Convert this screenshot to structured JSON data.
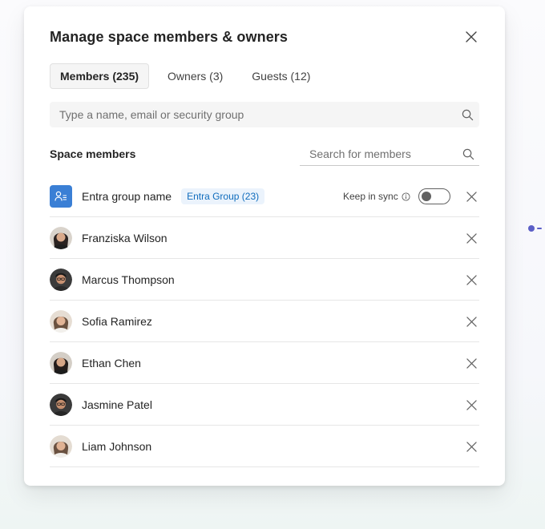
{
  "dialog": {
    "title": "Manage space members & owners"
  },
  "tabs": [
    {
      "label": "Members (235)",
      "active": true
    },
    {
      "label": "Owners (3)",
      "active": false
    },
    {
      "label": "Guests (12)",
      "active": false
    }
  ],
  "search": {
    "placeholder": "Type a name, email or security group"
  },
  "members_section": {
    "label": "Space members",
    "search_placeholder": "Search for members"
  },
  "group": {
    "name": "Entra group name",
    "badge": "Entra Group (23)",
    "sync_label": "Keep in sync",
    "sync_on": false
  },
  "members": [
    {
      "name": "Franziska Wilson"
    },
    {
      "name": "Marcus Thompson"
    },
    {
      "name": "Sofia Ramirez"
    },
    {
      "name": "Ethan Chen"
    },
    {
      "name": "Jasmine Patel"
    },
    {
      "name": "Liam Johnson"
    }
  ],
  "colors": {
    "accent": "#3a7fd5",
    "badge_bg": "#ebf3fc",
    "badge_text": "#0f6cbd",
    "decor_dot": "#5b5fc7"
  }
}
